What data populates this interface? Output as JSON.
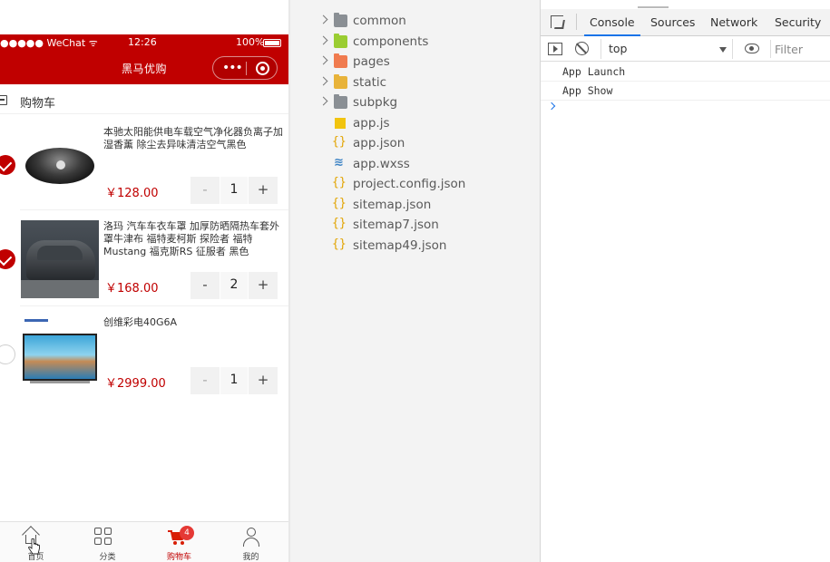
{
  "simulator": {
    "statusbar": {
      "carrier": "●●●●● WeChat",
      "wifi": "ᯤ",
      "time": "12:26",
      "battery": "100%"
    },
    "navbar": {
      "title": "黑马优购",
      "menu_dots": "•••"
    },
    "cart_header": {
      "label": "购物车"
    },
    "items": [
      {
        "title": "本驰太阳能供电车载空气净化器负离子加湿香薰 除尘去异味清洁空气黑色",
        "price": "￥128.00",
        "qty": "1",
        "checked": true
      },
      {
        "title": "洛玛 汽车车衣车罩 加厚防晒隔热车套外罩牛津布 福特麦柯斯 探险者 福特Mustang 福克斯RS 征服者 黑色",
        "price": "￥168.00",
        "qty": "2",
        "checked": true
      },
      {
        "title": "创维彩电40G6A",
        "price": "￥2999.00",
        "qty": "1",
        "checked": false
      }
    ],
    "stepper": {
      "minus": "-",
      "plus": "+"
    },
    "tabbar": [
      {
        "label": "首页"
      },
      {
        "label": "分类"
      },
      {
        "label": "购物车",
        "badge": "4"
      },
      {
        "label": "我的"
      }
    ]
  },
  "file_tree": [
    {
      "name": "common",
      "type": "folder",
      "color": "#8a8f94"
    },
    {
      "name": "components",
      "type": "folder",
      "color": "#9acd32"
    },
    {
      "name": "pages",
      "type": "folder",
      "color": "#f07b4f"
    },
    {
      "name": "static",
      "type": "folder",
      "color": "#e8b33a"
    },
    {
      "name": "subpkg",
      "type": "folder",
      "color": "#8a8f94"
    },
    {
      "name": "app.js",
      "type": "js"
    },
    {
      "name": "app.json",
      "type": "json"
    },
    {
      "name": "app.wxss",
      "type": "css"
    },
    {
      "name": "project.config.json",
      "type": "json"
    },
    {
      "name": "sitemap.json",
      "type": "json"
    },
    {
      "name": "sitemap7.json",
      "type": "json"
    },
    {
      "name": "sitemap49.json",
      "type": "json"
    }
  ],
  "devtools": {
    "tabs": [
      "Console",
      "Sources",
      "Network",
      "Security"
    ],
    "active_tab": "Console",
    "context": "top",
    "filter_placeholder": "Filter",
    "logs": [
      "App Launch",
      "App Show"
    ]
  },
  "colors": {
    "brand_red": "#c00000",
    "devtools_blue": "#1a73e8"
  }
}
